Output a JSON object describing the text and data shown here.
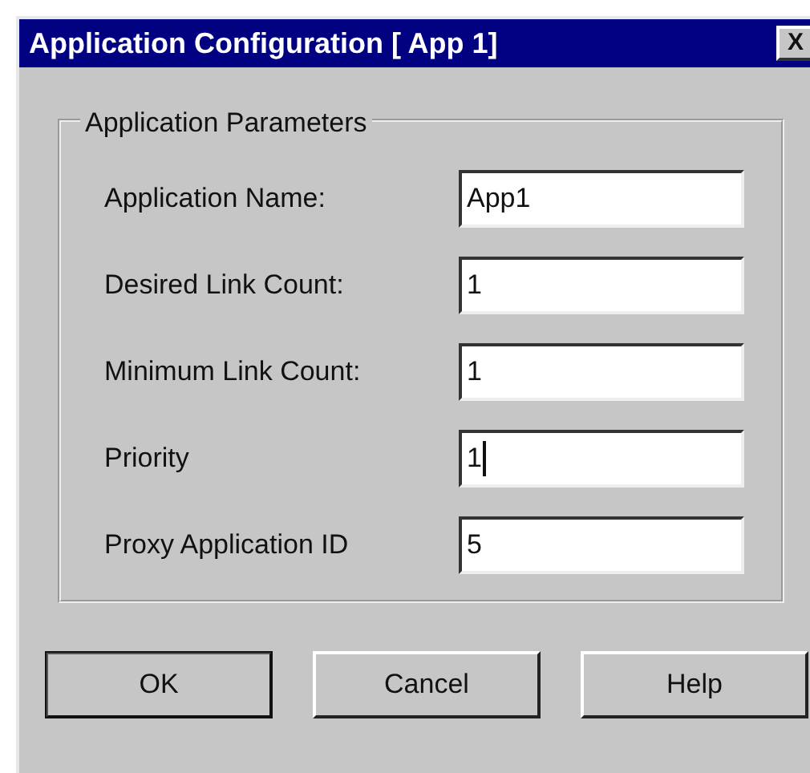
{
  "window": {
    "title": "Application Configuration [ App 1]",
    "close": "X"
  },
  "group": {
    "title": "Application Parameters",
    "fields": [
      {
        "label": "Application Name:",
        "value": "App1",
        "focused": false
      },
      {
        "label": "Desired Link Count:",
        "value": "1",
        "focused": false
      },
      {
        "label": "Minimum Link Count:",
        "value": "1",
        "focused": false
      },
      {
        "label": "Priority",
        "value": "1",
        "focused": true
      },
      {
        "label": "Proxy Application ID",
        "value": "5",
        "focused": false
      }
    ]
  },
  "buttons": [
    {
      "label": "OK",
      "default": true
    },
    {
      "label": "Cancel",
      "default": false
    },
    {
      "label": "Help",
      "default": false
    }
  ]
}
